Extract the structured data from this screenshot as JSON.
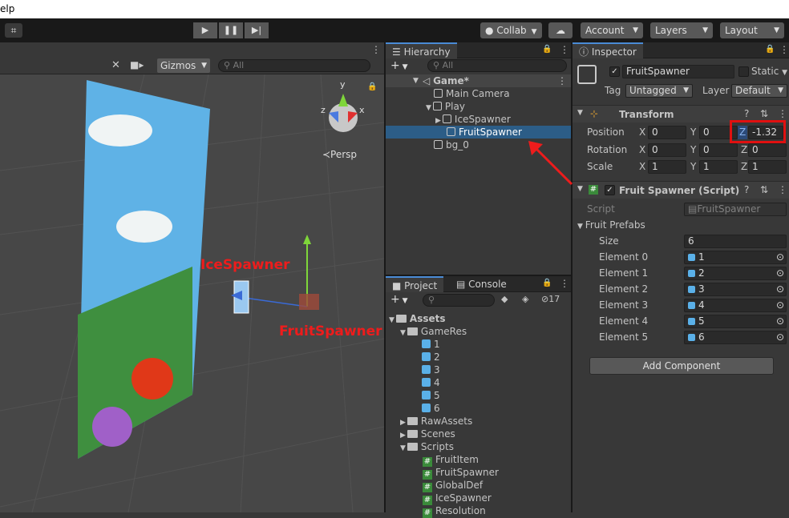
{
  "menubar": {
    "help": "elp"
  },
  "toolbar": {
    "collab": "Collab",
    "account": "Account",
    "layers": "Layers",
    "layout": "Layout"
  },
  "scene": {
    "gizmos": "Gizmos",
    "search_placeholder": "All",
    "persp": "≺Persp",
    "label_ice": "IceSpawner",
    "label_fruit": "FruitSpawner"
  },
  "hierarchy": {
    "tab": "Hierarchy",
    "search_placeholder": "All",
    "scene": "Game*",
    "items": [
      "Main Camera",
      "Play",
      "IceSpawner",
      "FruitSpawner",
      "bg_0"
    ]
  },
  "project": {
    "tab_project": "Project",
    "tab_console": "Console",
    "count": "17",
    "items": [
      "Assets",
      "GameRes",
      "1",
      "2",
      "3",
      "4",
      "5",
      "6",
      "RawAssets",
      "Scenes",
      "Scripts",
      "FruitItem",
      "FruitSpawner",
      "GlobalDef",
      "IceSpawner",
      "Resolution"
    ]
  },
  "inspector": {
    "tab": "Inspector",
    "name": "FruitSpawner",
    "static": "Static",
    "tag_label": "Tag",
    "tag": "Untagged",
    "layer_label": "Layer",
    "layer": "Default",
    "transform": "Transform",
    "position": {
      "label": "Position",
      "x": "0",
      "y": "0",
      "z": "-1.32"
    },
    "rotation": {
      "label": "Rotation",
      "x": "0",
      "y": "0",
      "z": "0"
    },
    "scale": {
      "label": "Scale",
      "x": "1",
      "y": "1",
      "z": "1"
    },
    "axis": {
      "x": "X",
      "y": "Y",
      "z": "Z"
    },
    "script_comp": "Fruit Spawner (Script)",
    "script_label": "Script",
    "script": "FruitSpawner",
    "prefabs": "Fruit Prefabs",
    "size_label": "Size",
    "size": "6",
    "elements": [
      {
        "label": "Element 0",
        "value": "1"
      },
      {
        "label": "Element 1",
        "value": "2"
      },
      {
        "label": "Element 2",
        "value": "3"
      },
      {
        "label": "Element 3",
        "value": "4"
      },
      {
        "label": "Element 4",
        "value": "5"
      },
      {
        "label": "Element 5",
        "value": "6"
      }
    ],
    "add_component": "Add Component"
  },
  "colors": {
    "selection": "#2c5d87",
    "highlight": "#e01010",
    "accent": "#4a8bd6"
  }
}
